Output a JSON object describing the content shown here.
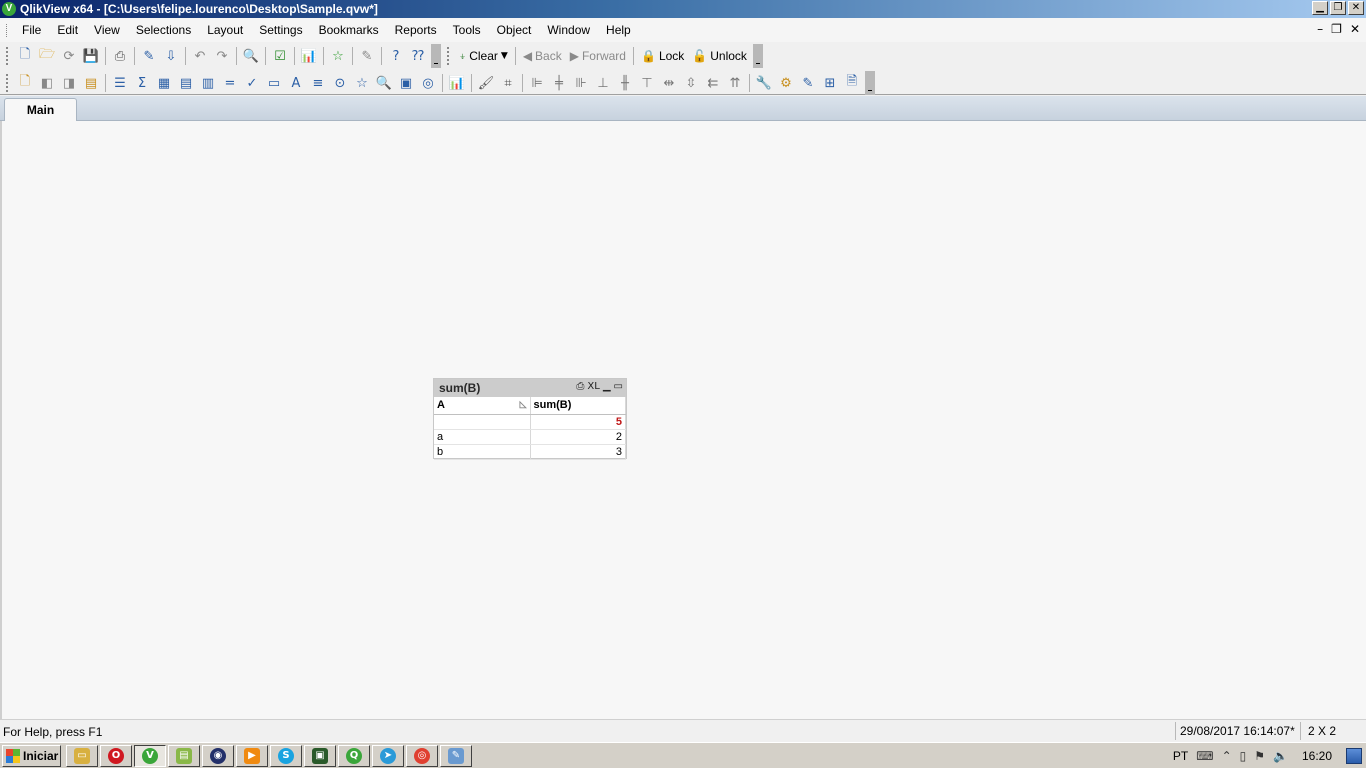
{
  "window": {
    "title": "QlikView x64 - [C:\\Users\\felipe.lourenco\\Desktop\\Sample.qvw*]",
    "app_icon_letter": "V",
    "controls": {
      "minimize": "▁",
      "restore": "❐",
      "close": "✕"
    }
  },
  "menu": {
    "items": [
      "File",
      "Edit",
      "View",
      "Selections",
      "Layout",
      "Settings",
      "Bookmarks",
      "Reports",
      "Tools",
      "Object",
      "Window",
      "Help"
    ],
    "doc_controls": {
      "minimize": "–",
      "restore": "❐",
      "close": "✕"
    }
  },
  "toolbar1": {
    "clear_label": "Clear",
    "back_label": "Back",
    "forward_label": "Forward",
    "lock_label": "Lock",
    "unlock_label": "Unlock"
  },
  "tabs": [
    {
      "label": "Main"
    }
  ],
  "sheet_object": {
    "caption": "sum(B)",
    "caption_icons": {
      "print": "⎙",
      "excel": "XL",
      "minimize": "▁",
      "maximize": "▭"
    },
    "columns": [
      "A",
      "sum(B)"
    ],
    "total": {
      "dim": "",
      "value": "5"
    },
    "rows": [
      {
        "dim": "a",
        "value": "2"
      },
      {
        "dim": "b",
        "value": "3"
      }
    ]
  },
  "statusbar": {
    "help_text": "For Help, press F1",
    "timestamp": "29/08/2017 16:14:07*",
    "table_dims": "2 X 2"
  },
  "taskbar": {
    "start_label": "Iniciar",
    "language": "PT",
    "clock": "16:20"
  }
}
